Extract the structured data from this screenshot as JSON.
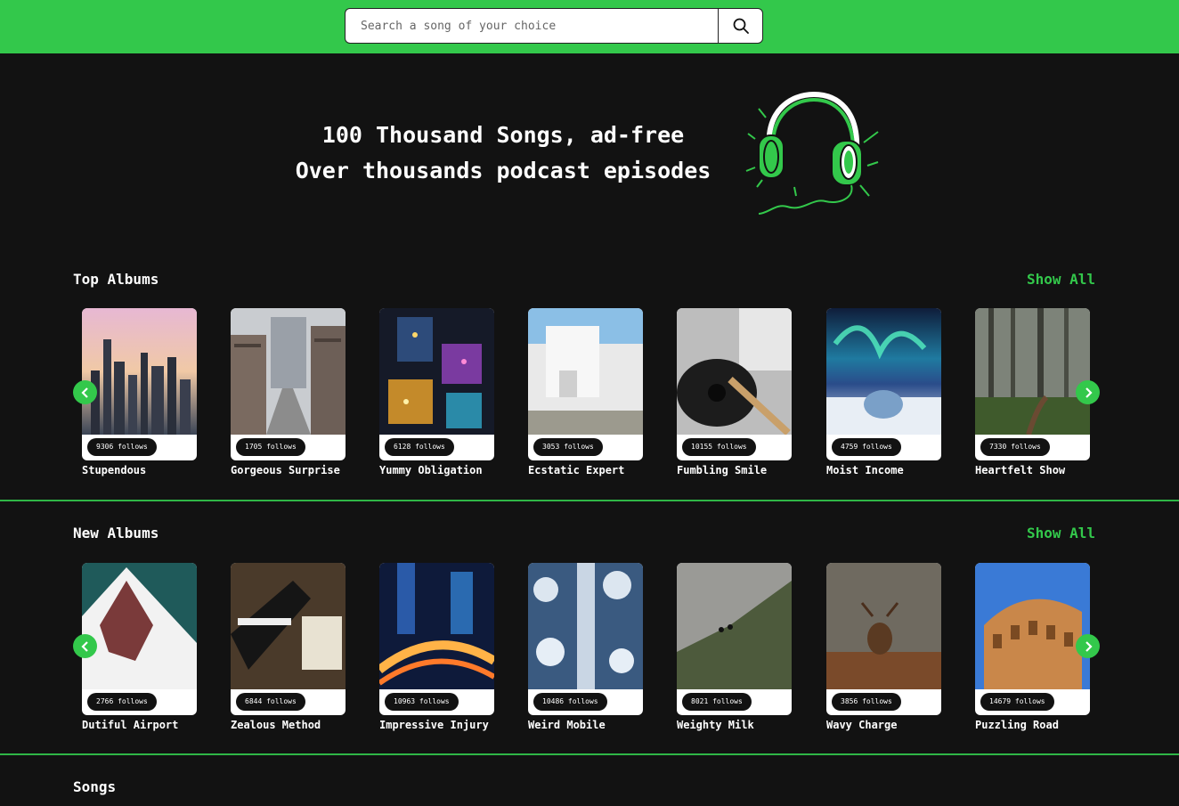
{
  "search": {
    "placeholder": "Search a song of your choice",
    "icon": "search-icon"
  },
  "hero": {
    "line1": "100 Thousand Songs, ad-free",
    "line2": "Over thousands podcast episodes",
    "art_icon": "headphones-icon"
  },
  "colors": {
    "accent": "#33c84b",
    "background": "#121212",
    "card": "#ffffff"
  },
  "top_albums": {
    "title": "Top Albums",
    "show_all": "Show All",
    "items": [
      {
        "name": "Stupendous",
        "follows": "9306 follows"
      },
      {
        "name": "Gorgeous Surprise",
        "follows": "1705 follows"
      },
      {
        "name": "Yummy Obligation",
        "follows": "6128 follows"
      },
      {
        "name": "Ecstatic Expert",
        "follows": "3053 follows"
      },
      {
        "name": "Fumbling Smile",
        "follows": "10155 follows"
      },
      {
        "name": "Moist Income",
        "follows": "4759 follows"
      },
      {
        "name": "Heartfelt Show",
        "follows": "7330 follows"
      }
    ]
  },
  "new_albums": {
    "title": "New Albums",
    "show_all": "Show All",
    "items": [
      {
        "name": "Dutiful Airport",
        "follows": "2766 follows"
      },
      {
        "name": "Zealous Method",
        "follows": "6844 follows"
      },
      {
        "name": "Impressive Injury",
        "follows": "10963 follows"
      },
      {
        "name": "Weird Mobile",
        "follows": "10486 follows"
      },
      {
        "name": "Weighty Milk",
        "follows": "8021 follows"
      },
      {
        "name": "Wavy Charge",
        "follows": "3856 follows"
      },
      {
        "name": "Puzzling Road",
        "follows": "14679 follows"
      }
    ]
  },
  "songs": {
    "title": "Songs"
  }
}
